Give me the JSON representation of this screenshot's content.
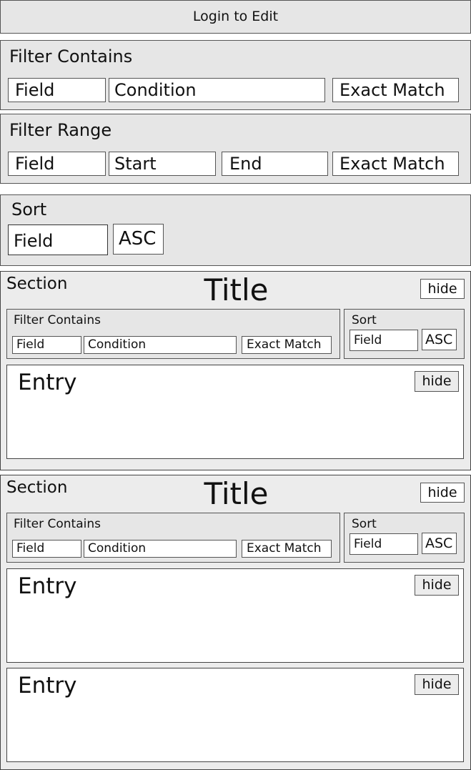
{
  "login_button": "Login to Edit",
  "filter_contains": {
    "title": "Filter Contains",
    "field": "Field",
    "condition": "Condition",
    "exact_match": "Exact Match"
  },
  "filter_range": {
    "title": "Filter Range",
    "field": "Field",
    "start": "Start",
    "end": "End",
    "exact_match": "Exact Match"
  },
  "sort": {
    "title": "Sort",
    "field": "Field",
    "order": "ASC"
  },
  "sections": [
    {
      "label": "Section",
      "title": "Title",
      "hide": "hide",
      "filter_contains": {
        "title": "Filter Contains",
        "field": "Field",
        "condition": "Condition",
        "exact_match": "Exact Match"
      },
      "sort": {
        "title": "Sort",
        "field": "Field",
        "order": "ASC"
      },
      "entries": [
        {
          "title": "Entry",
          "hide": "hide"
        }
      ]
    },
    {
      "label": "Section",
      "title": "Title",
      "hide": "hide",
      "filter_contains": {
        "title": "Filter Contains",
        "field": "Field",
        "condition": "Condition",
        "exact_match": "Exact Match"
      },
      "sort": {
        "title": "Sort",
        "field": "Field",
        "order": "ASC"
      },
      "entries": [
        {
          "title": "Entry",
          "hide": "hide"
        },
        {
          "title": "Entry",
          "hide": "hide"
        }
      ]
    }
  ]
}
